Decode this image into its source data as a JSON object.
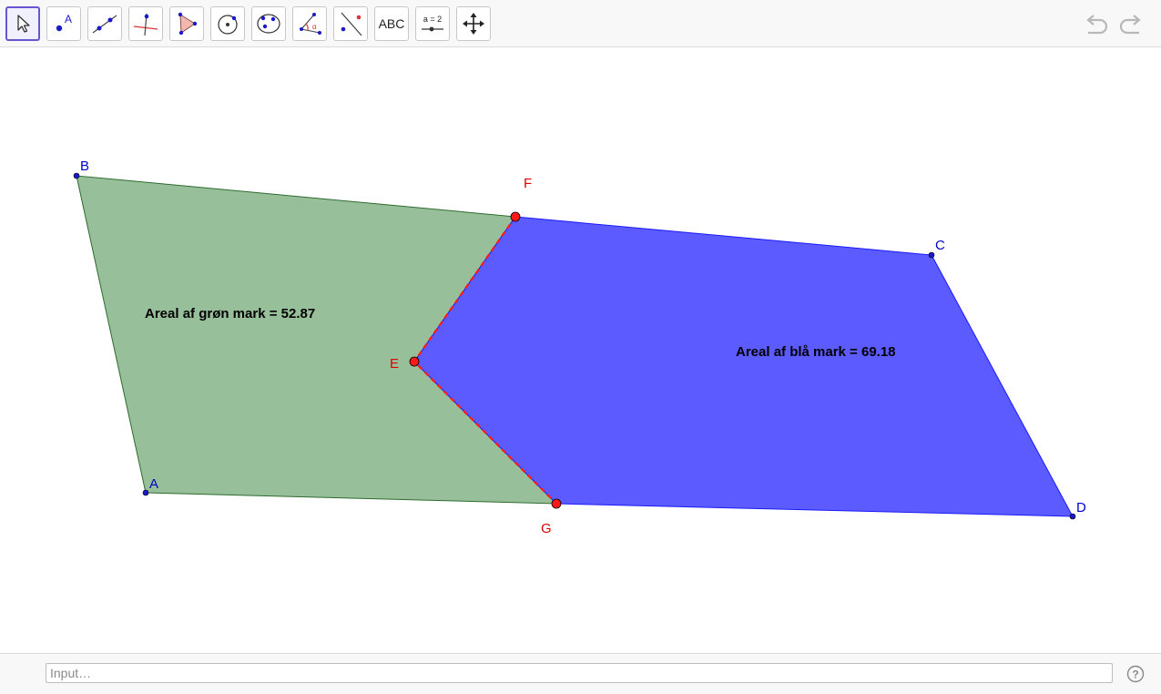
{
  "toolbar": {
    "tools": [
      {
        "name": "move-tool",
        "icon": "arrow-cursor-icon",
        "selected": true
      },
      {
        "name": "point-tool",
        "icon": "point-icon",
        "label": "A"
      },
      {
        "name": "line-tool",
        "icon": "line-through-points-icon"
      },
      {
        "name": "perpendicular-line-tool",
        "icon": "perpendicular-line-icon"
      },
      {
        "name": "polygon-tool",
        "icon": "polygon-icon"
      },
      {
        "name": "circle-tool",
        "icon": "circle-center-point-icon"
      },
      {
        "name": "conic-tool",
        "icon": "ellipse-icon"
      },
      {
        "name": "angle-tool",
        "icon": "angle-icon",
        "label": "α"
      },
      {
        "name": "reflect-tool",
        "icon": "reflect-about-line-icon"
      },
      {
        "name": "text-tool",
        "icon": "text-icon",
        "label": "ABC"
      },
      {
        "name": "slider-tool",
        "icon": "slider-icon",
        "label": "a = 2"
      },
      {
        "name": "move-graphics-view-tool",
        "icon": "move-arrows-icon"
      }
    ],
    "undo_icon": "undo-icon",
    "redo_icon": "redo-icon"
  },
  "graphics": {
    "colors": {
      "green_fill": "#97c09a",
      "green_edge": "#2e6b2e",
      "blue_fill": "#5b5bff",
      "blue_edge": "#1a1aff",
      "point_blue": "#1a1acc",
      "point_red": "#ff1a1a",
      "label_blue": "#0000cc",
      "label_red": "#dd0000"
    },
    "points": {
      "A": "A",
      "B": "B",
      "C": "C",
      "D": "D",
      "E": "E",
      "F": "F",
      "G": "G"
    },
    "texts": {
      "green_area": "Areal af grøn mark = 52.87",
      "blue_area": "Areal af blå mark = 69.18"
    }
  },
  "input_bar": {
    "placeholder": "Input…",
    "help_icon": "help-icon",
    "help_label": "?"
  }
}
